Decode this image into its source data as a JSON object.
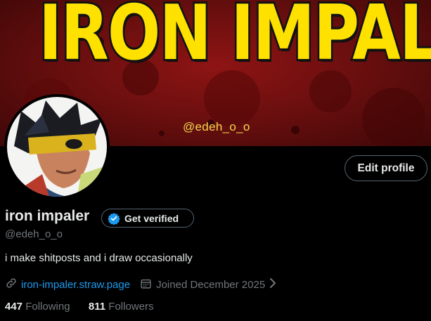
{
  "banner": {
    "title": "IRON IMPALER",
    "handle_text": "@edeh_o_o",
    "title_color": "#ffe100",
    "background_color": "#6c0f0f"
  },
  "avatar": {
    "icon": "avatar-image"
  },
  "profile": {
    "edit_label": "Edit profile",
    "display_name": "iron impaler",
    "verify_label": "Get verified",
    "handle": "@edeh_o_o",
    "bio": "i make shitposts and i draw occasionally",
    "link_text": "iron-impaler.straw.page",
    "joined_text": "Joined December 2025",
    "following_count": "447",
    "following_label": "Following",
    "followers_count": "811",
    "followers_label": "Followers"
  },
  "colors": {
    "accent": "#1d9bf0",
    "muted": "#71767b",
    "text": "#e7e9ea",
    "border": "#536471"
  }
}
